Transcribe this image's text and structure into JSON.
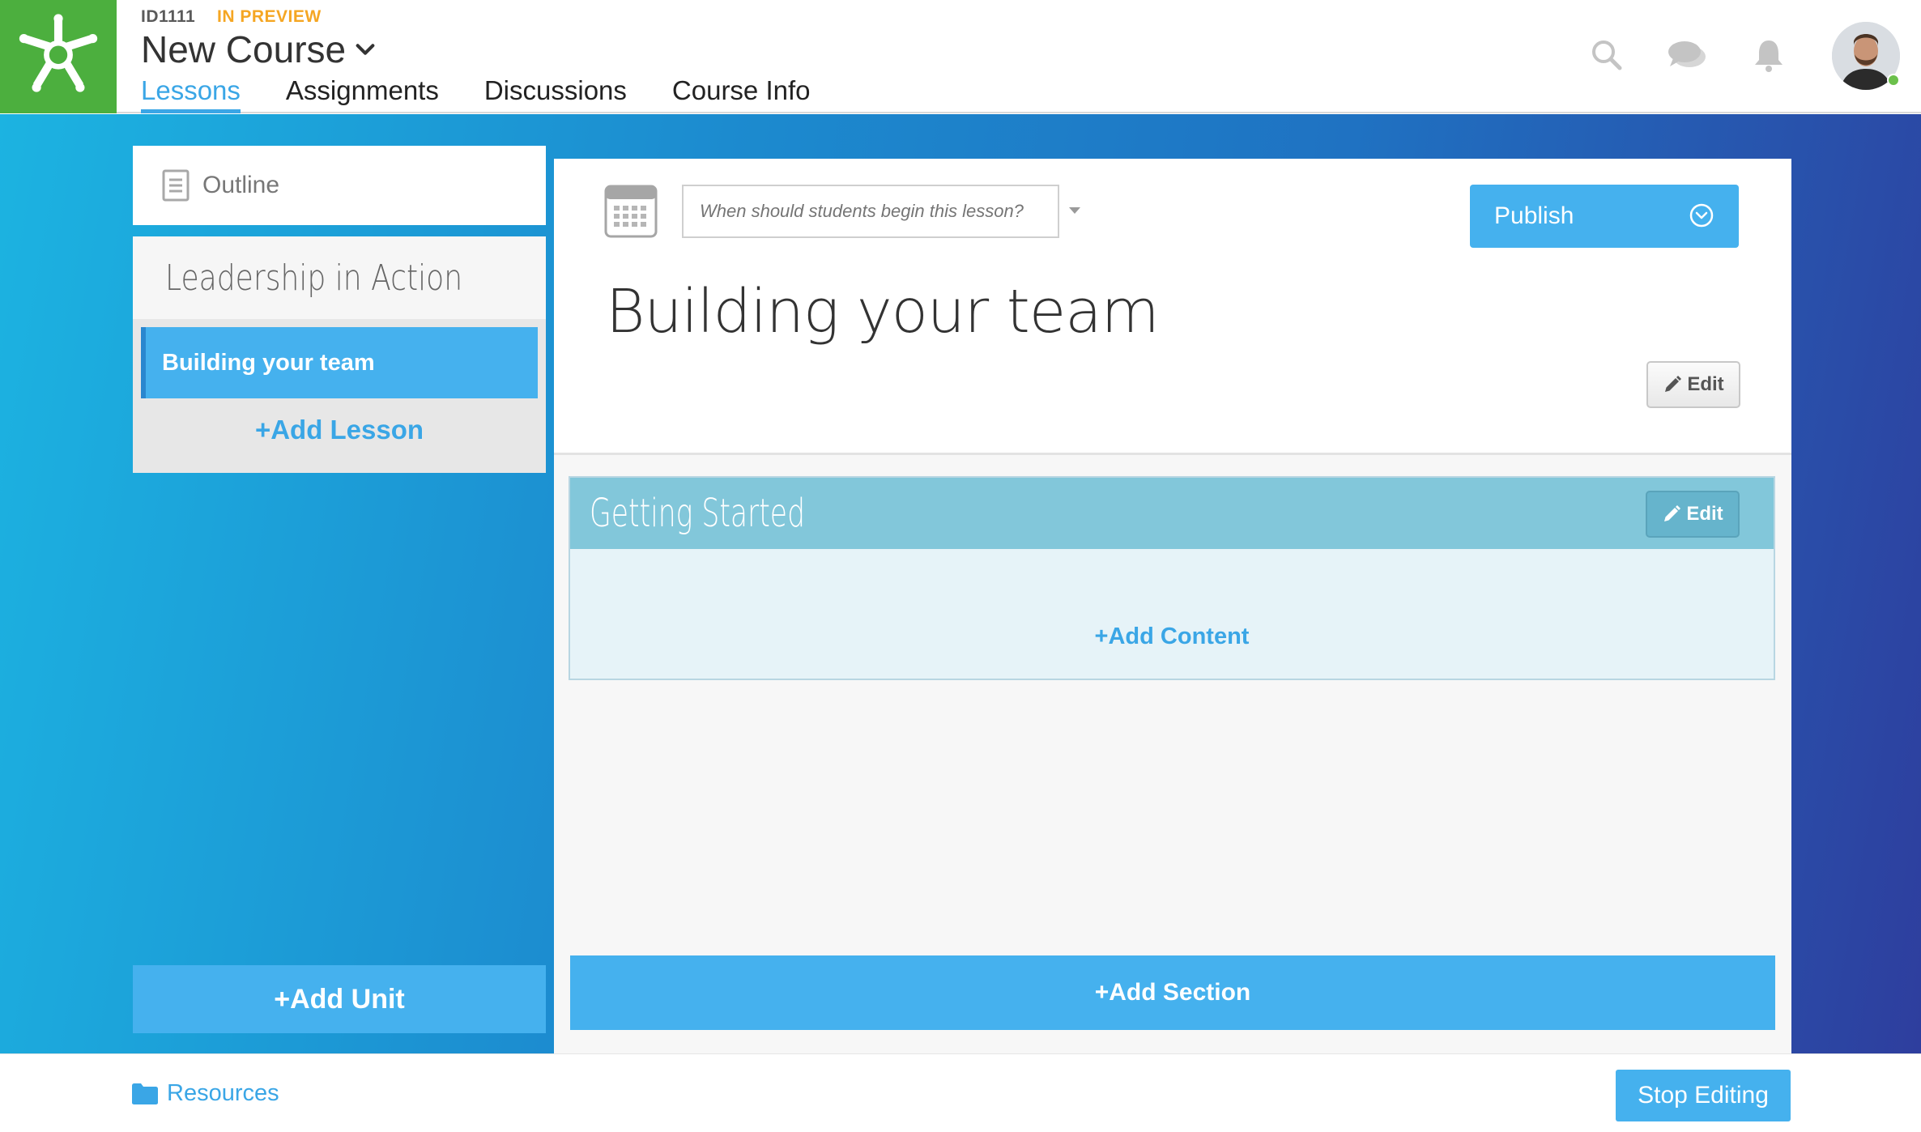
{
  "header": {
    "course_id": "ID1111",
    "status": "IN PREVIEW",
    "course_title": "New Course",
    "tabs": [
      {
        "label": "Lessons",
        "active": true
      },
      {
        "label": "Assignments",
        "active": false
      },
      {
        "label": "Discussions",
        "active": false
      },
      {
        "label": "Course Info",
        "active": false
      }
    ],
    "icons": [
      "search-icon",
      "chat-icon",
      "bell-icon"
    ],
    "user_online": true
  },
  "sidebar": {
    "outline_label": "Outline",
    "unit_title": "Leadership in Action",
    "lessons": [
      {
        "label": "Building your team",
        "selected": true
      }
    ],
    "add_lesson_label": "+Add Lesson",
    "add_unit_label": "+Add Unit"
  },
  "lesson": {
    "date_placeholder": "When should students begin this lesson?",
    "publish_label": "Publish",
    "title": "Building your team",
    "edit_label": "Edit"
  },
  "sections": [
    {
      "title": "Getting Started",
      "edit_label": "Edit",
      "add_content_label": "+Add Content"
    }
  ],
  "add_section_label": "+Add Section",
  "footer": {
    "resources_label": "Resources",
    "stop_editing_label": "Stop Editing"
  },
  "colors": {
    "accent": "#45b1ee",
    "brand_green": "#4caf3e",
    "preview_orange": "#f5a623",
    "section_header": "#82c7da"
  }
}
